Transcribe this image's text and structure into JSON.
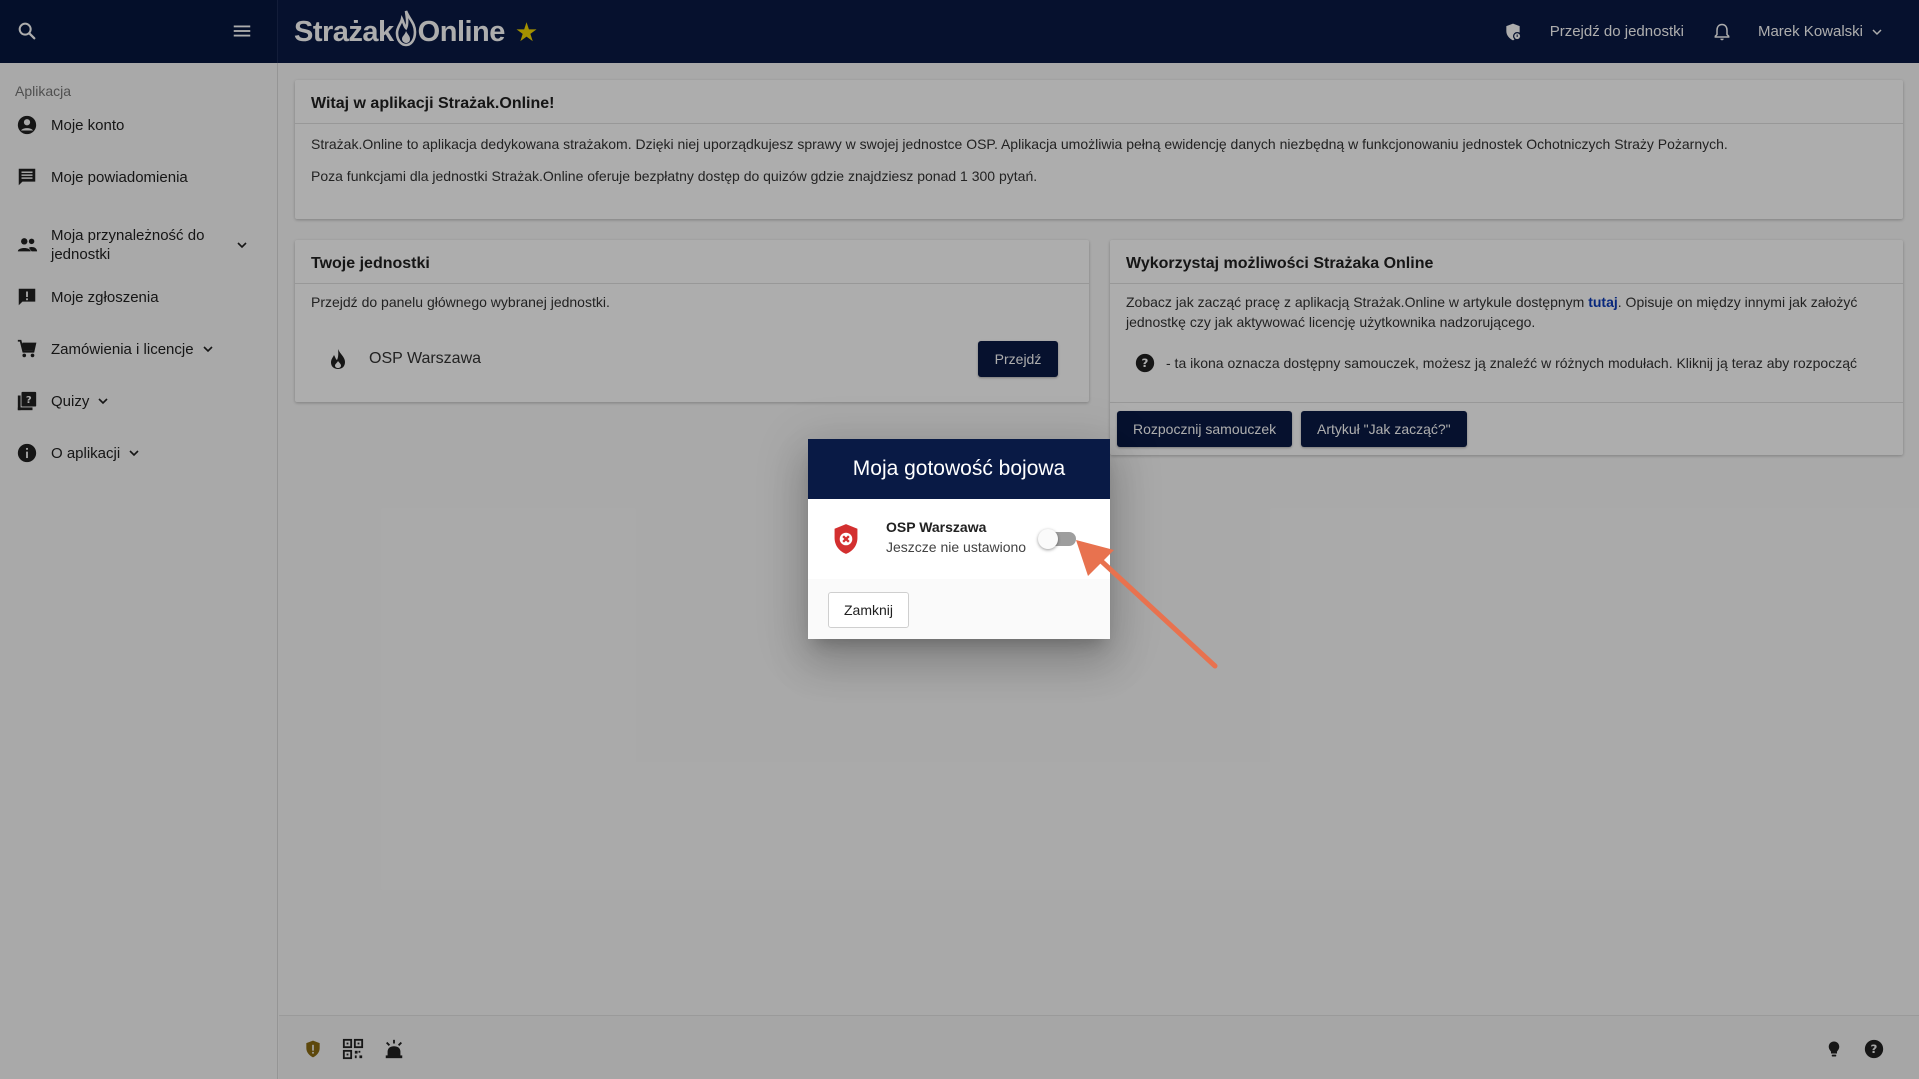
{
  "topbar": {
    "logo_left": "Strażak",
    "logo_right": "Online",
    "goto_unit": "Przejdź do jednostki",
    "user_name": "Marek Kowalski"
  },
  "sidebar": {
    "header": "Aplikacja",
    "items": [
      {
        "label": "Moje konto",
        "icon": "account-circle-icon"
      },
      {
        "label": "Moje powiadomienia",
        "icon": "message-icon"
      },
      {
        "label": "Moja przynależność do jednostki",
        "icon": "people-icon"
      },
      {
        "label": "Moje zgłoszenia",
        "icon": "report-icon"
      },
      {
        "label": "Zamówienia i licencje",
        "icon": "cart-icon"
      },
      {
        "label": "Quizy",
        "icon": "quiz-icon"
      },
      {
        "label": "O aplikacji",
        "icon": "info-icon"
      }
    ]
  },
  "welcome": {
    "title": "Witaj w aplikacji Strażak.Online!",
    "p1": "Strażak.Online to aplikacja dedykowana strażakom. Dzięki niej uporządkujesz sprawy w swojej jednostce OSP. Aplikacja umożliwia pełną ewidencję danych niezbędną w funkcjonowaniu jednostek Ochotniczych Straży Pożarnych.",
    "p2": "Poza funkcjami dla jednostki Strażak.Online oferuje bezpłatny dostęp do quizów gdzie znajdziesz ponad 1 300 pytań."
  },
  "units": {
    "title": "Twoje jednostki",
    "subtitle": "Przejdź do panelu głównego wybranej jednostki.",
    "unit_name": "OSP Warszawa",
    "go_button": "Przejdź"
  },
  "usage": {
    "title": "Wykorzystaj możliwości Strażaka Online",
    "text_before": "Zobacz jak zacząć pracę z aplikacją Strażak.Online w artykule dostępnym ",
    "link": "tutaj",
    "text_after": ". Opisuje on między innymi jak założyć jednostkę czy jak aktywować licencję użytkownika nadzorującego.",
    "help_text": "- ta ikona oznacza dostępny samouczek, możesz ją znaleźć w różnych modułach. Kliknij ją teraz aby rozpocząć",
    "btn_tutorial": "Rozpocznij samouczek",
    "btn_article": "Artykuł \"Jak zacząć?\""
  },
  "dialog": {
    "title": "Moja gotowość bojowa",
    "unit_name": "OSP Warszawa",
    "status": "Jeszcze nie ustawiono",
    "toggle_on": false,
    "close_button": "Zamknij"
  },
  "colors": {
    "primary": "#091a45",
    "accent_star": "#f2d600",
    "shield_red": "#d32f2f",
    "arrow": "#e8724f"
  }
}
